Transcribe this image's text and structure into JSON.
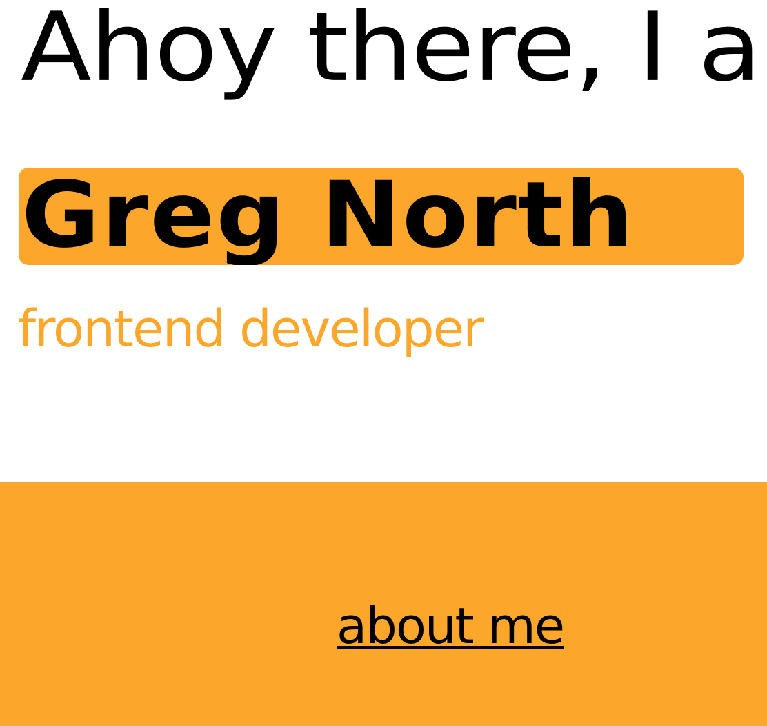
{
  "hero": {
    "greeting": "Ahoy there, I a",
    "name": "Greg North",
    "role": "frontend developer"
  },
  "about": {
    "link_label": "about me"
  },
  "colors": {
    "accent": "#fca72c",
    "text": "#000000",
    "background": "#ffffff"
  }
}
